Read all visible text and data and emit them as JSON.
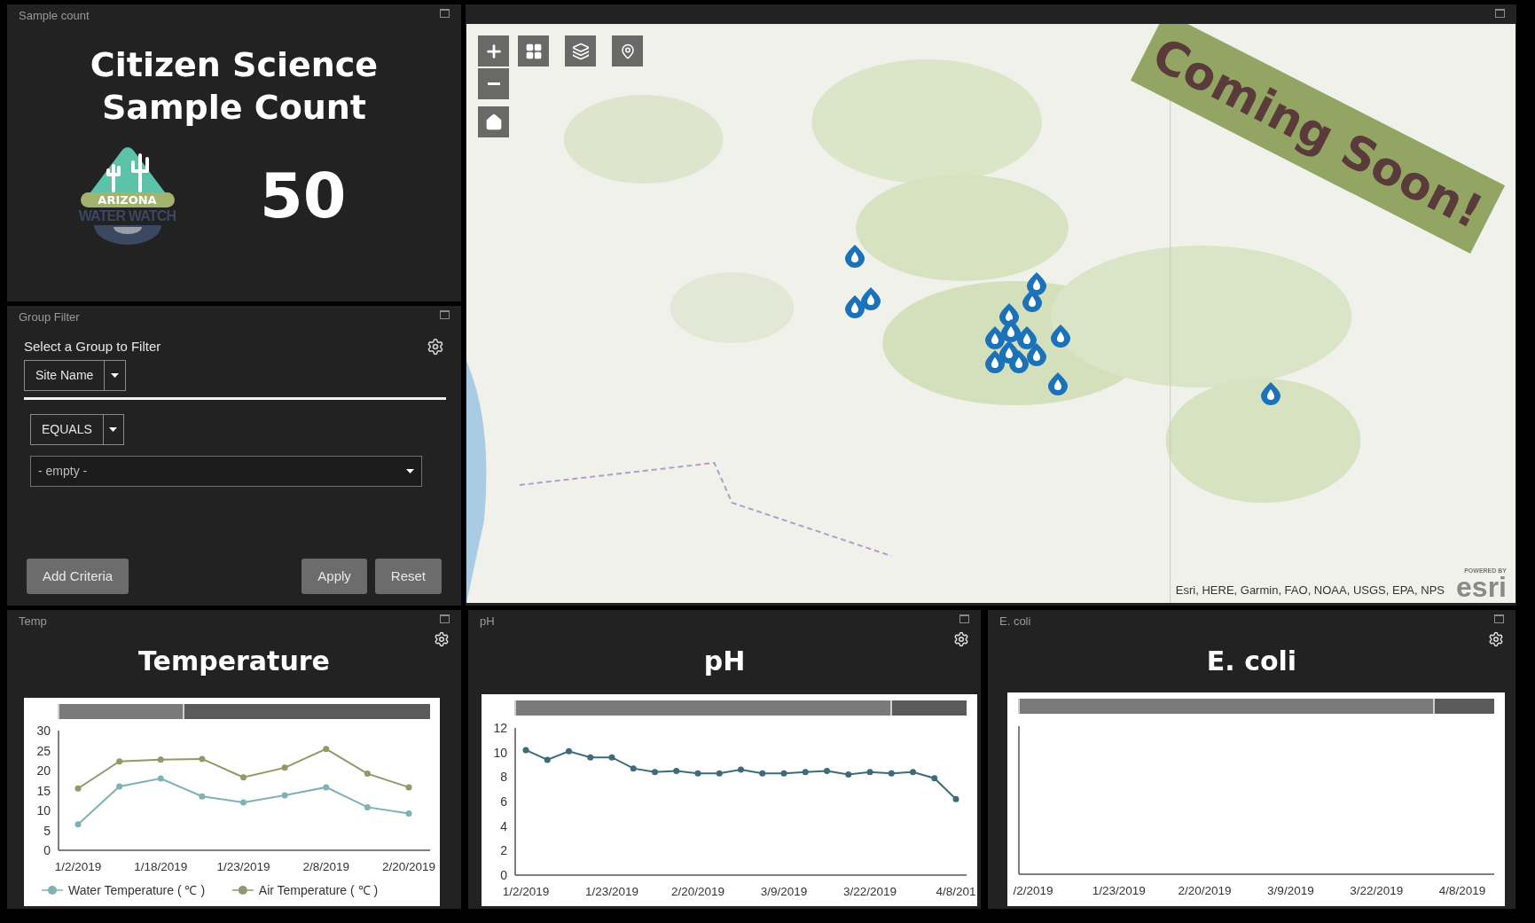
{
  "sample_count_panel": {
    "header": "Sample count",
    "title_lines": [
      "Citizen Science",
      "Sample Count"
    ],
    "logo": {
      "banner": "ARIZONA",
      "wordmark": "WATER WATCH"
    },
    "count": "50"
  },
  "group_filter_panel": {
    "header": "Group Filter",
    "prompt": "Select a Group to Filter",
    "field_select": "Site Name",
    "operator_select": "EQUALS",
    "value_select": {
      "placeholder": "- empty -"
    },
    "buttons": [
      "Add Criteria",
      "Apply",
      "Reset"
    ]
  },
  "map_panel": {
    "banner": "Coming Soon!",
    "attribution": "Esri, HERE, Garmin, FAO, NOAA, USGS, EPA, NPS",
    "logo": {
      "caption": "POWERED BY",
      "wordmark": "esri"
    }
  },
  "chart_panels": [
    {
      "header": "Temp",
      "title": "Temperature",
      "range_slider": {
        "level": 0.34
      },
      "chart_data": {
        "type": "line",
        "categories": [
          "1/2/2019",
          null,
          "1/18/2019",
          null,
          "1/23/2019",
          null,
          "2/8/2019",
          null,
          "2/20/2019"
        ],
        "ylim": [
          0,
          30
        ],
        "yticks": [
          0,
          5,
          10,
          15,
          20,
          25,
          30
        ],
        "series": [
          {
            "name": "Water Temperature ( ℃ )",
            "color": "#7fb2b4",
            "marker": "circle",
            "values": [
              6.5,
              16,
              18,
              13.5,
              12,
              13.8,
              15.8,
              10.8,
              9.2
            ]
          },
          {
            "name": "Air Temperature ( ℃ )",
            "color": "#8e9a68",
            "marker": "circle",
            "values": [
              15.5,
              22.3,
              22.7,
              22.9,
              18.3,
              20.7,
              25.4,
              19.2,
              15.8
            ]
          }
        ],
        "legend": true
      }
    },
    {
      "header": "pH",
      "title": "pH",
      "range_slider": {
        "level": 0.835
      },
      "chart_data": {
        "type": "line",
        "categories": [
          "1/2/2019",
          null,
          null,
          null,
          "1/23/2019",
          null,
          null,
          null,
          "2/20/2019",
          null,
          null,
          null,
          "3/9/2019",
          null,
          null,
          null,
          "3/22/2019",
          null,
          null,
          null,
          "4/8/201"
        ],
        "ylim": [
          0,
          12
        ],
        "yticks": [
          0,
          2,
          4,
          6,
          8,
          10,
          12
        ],
        "series": [
          {
            "color": "#3d6c78",
            "marker": "circle",
            "values": [
              10.2,
              9.4,
              10.1,
              9.6,
              9.6,
              8.7,
              8.4,
              8.5,
              8.3,
              8.3,
              8.6,
              8.3,
              8.3,
              8.4,
              8.5,
              8.2,
              8.4,
              8.3,
              8.4,
              7.9,
              6.2
            ]
          }
        ]
      }
    },
    {
      "header": "E. coli",
      "title": "E. coli",
      "range_slider": {
        "level": 0.875
      },
      "chart_data": {
        "type": "other",
        "categories": [
          "/2/2019",
          "1/23/2019",
          "2/20/2019",
          "3/9/2019",
          "3/22/2019",
          "4/8/2019"
        ]
      }
    }
  ]
}
